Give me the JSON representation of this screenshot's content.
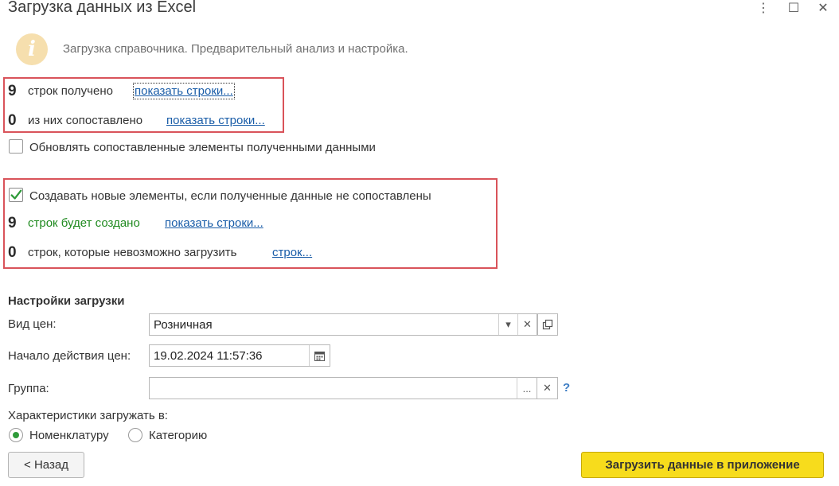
{
  "window": {
    "title": "Загрузка данных из Excel",
    "buttons": {
      "menu": "⋮",
      "maximize": "☐",
      "close": "✕"
    }
  },
  "info": {
    "icon": "info-icon",
    "icon_glyph": "i",
    "text": "Загрузка справочника. Предварительный анализ и настройка."
  },
  "received": {
    "rows_count": "9",
    "rows_label": "строк получено",
    "rows_link": "показать строки...",
    "matched_count": "0",
    "matched_label": "из них сопоставлено",
    "matched_link": "показать строки..."
  },
  "update_matched": {
    "checked": false,
    "label": "Обновлять сопоставленные элементы полученными данными"
  },
  "create_new": {
    "checked": true,
    "label": "Создавать новые элементы, если полученные данные не сопоставлены",
    "created_count": "9",
    "created_label": "строк будет создано",
    "created_link": "показать строки...",
    "failed_count": "0",
    "failed_label": "строк, которые невозможно загрузить",
    "failed_link": "строк..."
  },
  "settings": {
    "title": "Настройки загрузки",
    "price_type": {
      "label": "Вид цен:",
      "value": "Розничная"
    },
    "price_start": {
      "label": "Начало действия цен:",
      "value": "19.02.2024 11:57:36"
    },
    "group": {
      "label": "Группа:",
      "value": "",
      "ellipsis": "...",
      "help": "?"
    },
    "characteristics": {
      "label": "Характеристики загружать в:",
      "options": [
        "Номенклатуру",
        "Категорию"
      ],
      "selected": "Номенклатуру"
    }
  },
  "footer": {
    "back_label": "< Назад",
    "load_label": "Загрузить данные в приложение"
  },
  "colors": {
    "highlight_border": "#d9535a",
    "link": "#1a5da8",
    "green_text": "#1f8a1f",
    "primary_button": "#f7dc1c",
    "checkmark": "#2f9b3a"
  }
}
